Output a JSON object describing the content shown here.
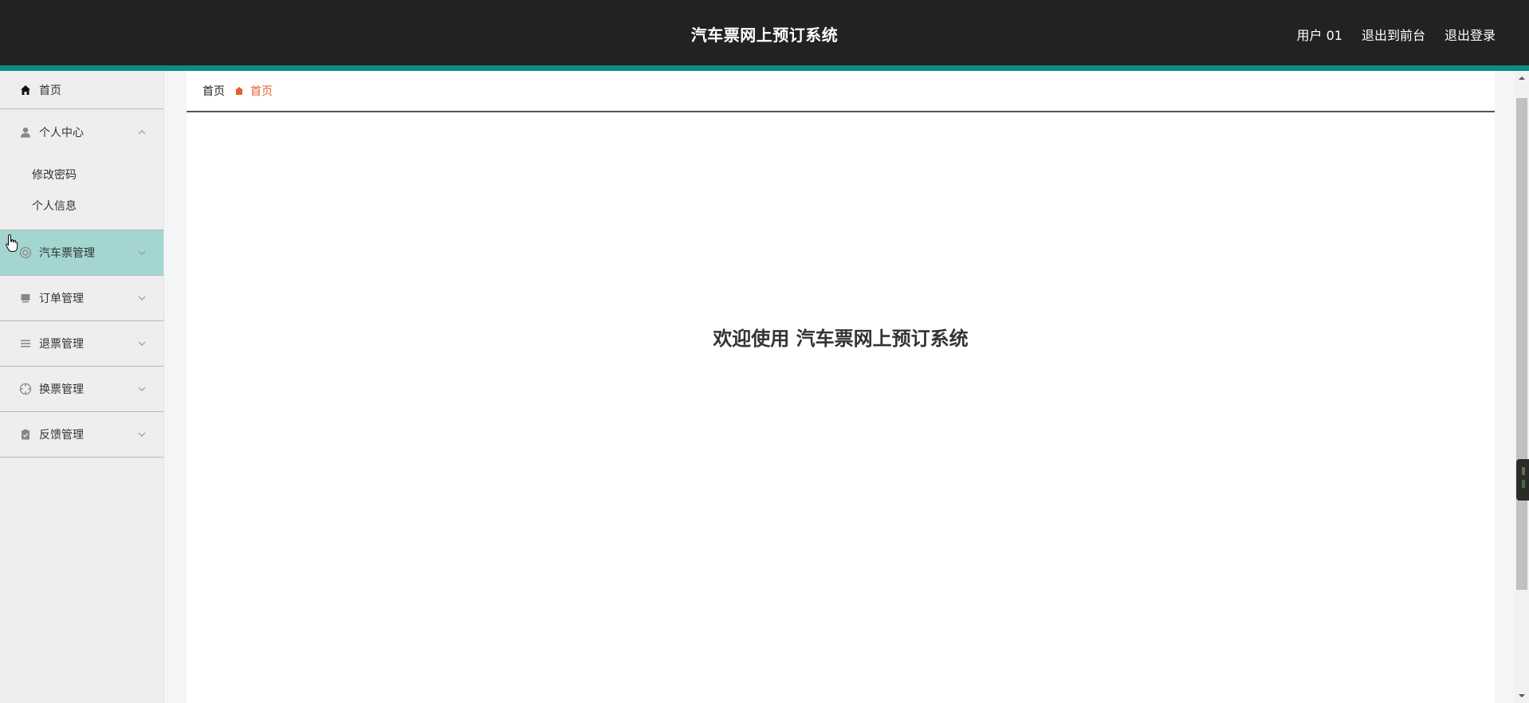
{
  "header": {
    "title": "汽车票网上预订系统",
    "user_label": "用户 01",
    "front_label": "退出到前台",
    "logout_label": "退出登录"
  },
  "sidebar": {
    "home": {
      "label": "首页",
      "icon": "home-icon"
    },
    "personal": {
      "label": "个人中心",
      "icon": "user-icon",
      "expanded": true,
      "children": [
        {
          "label": "修改密码"
        },
        {
          "label": "个人信息"
        }
      ]
    },
    "items": [
      {
        "label": "汽车票管理",
        "icon": "gear-circle-icon",
        "active": true
      },
      {
        "label": "订单管理",
        "icon": "monitor-icon"
      },
      {
        "label": "退票管理",
        "icon": "list-icon"
      },
      {
        "label": "换票管理",
        "icon": "compass-icon"
      },
      {
        "label": "反馈管理",
        "icon": "clipboard-icon"
      }
    ]
  },
  "breadcrumb": {
    "root": "首页",
    "current": "首页"
  },
  "main": {
    "welcome": "欢迎使用 汽车票网上预订系统"
  },
  "colors": {
    "header_bg": "#222222",
    "accent": "#0e8b80",
    "active_menu": "#a3d6d0",
    "breadcrumb_current": "#e1622b"
  }
}
